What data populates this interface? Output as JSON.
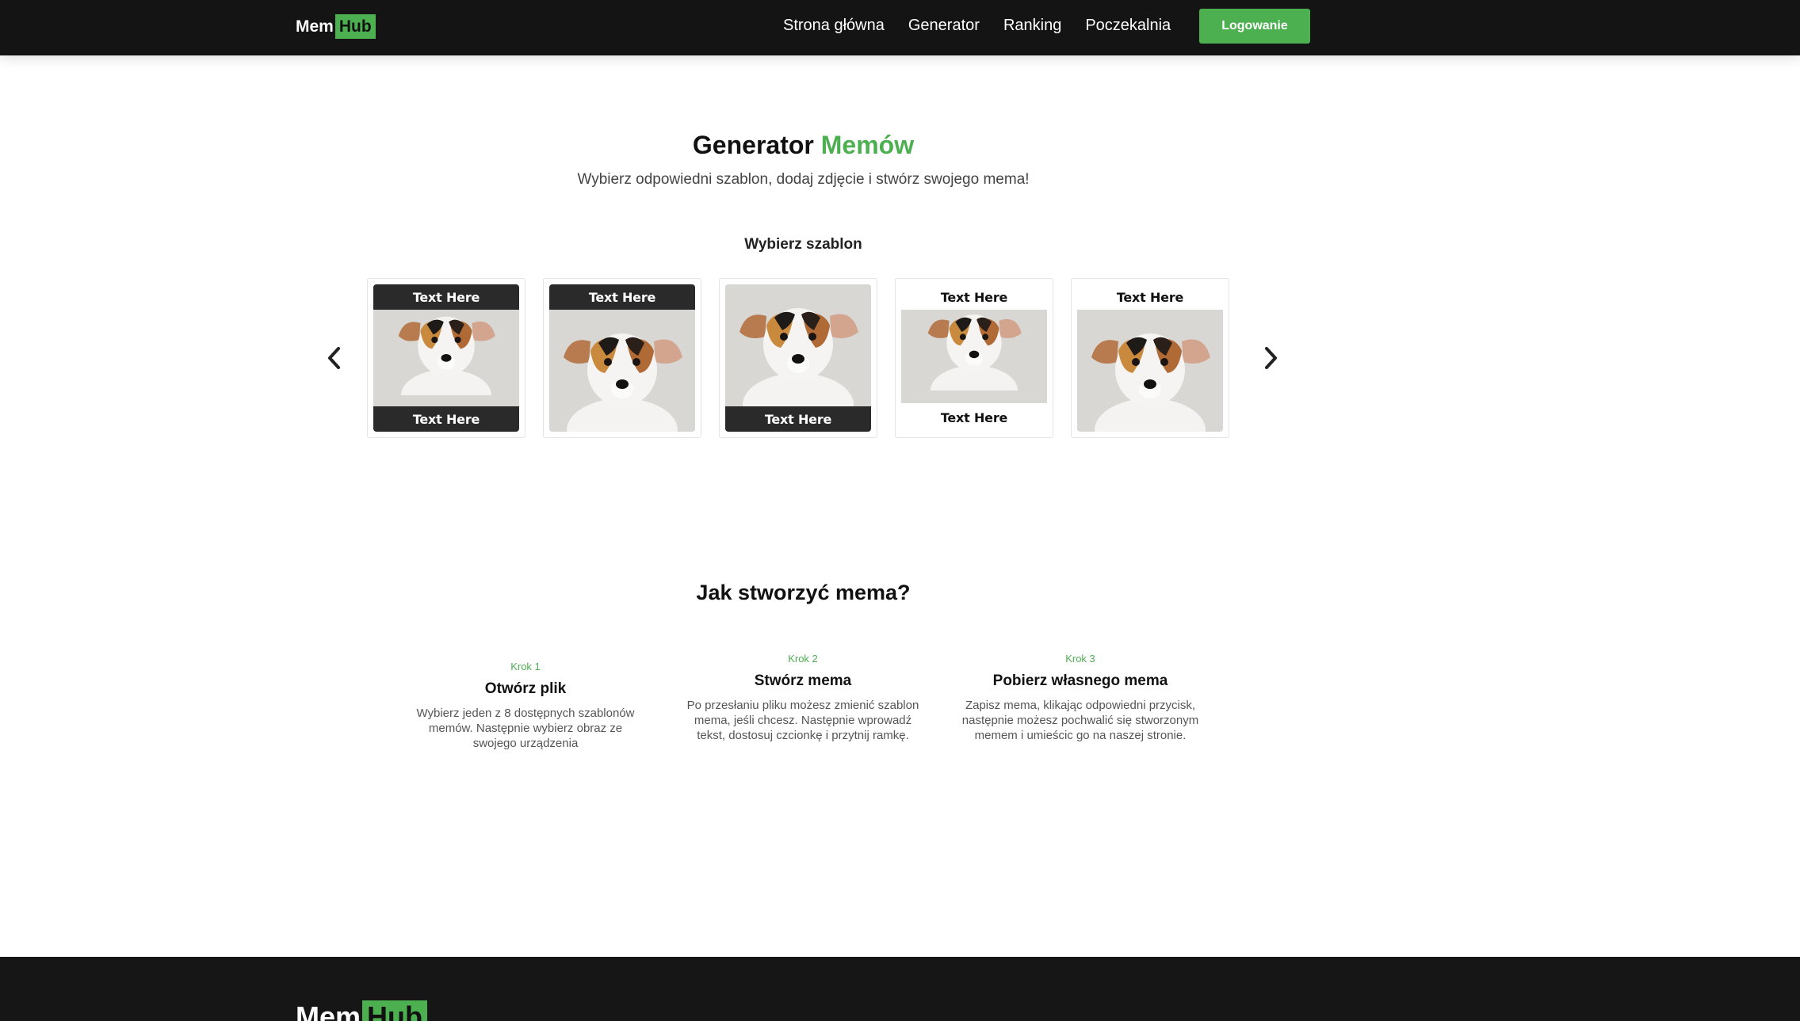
{
  "brand": {
    "part1": "Mem",
    "part2": "Hub",
    "accent": "#4caf50"
  },
  "nav": {
    "links": [
      "Strona główna",
      "Generator",
      "Ranking",
      "Poczekalnia"
    ],
    "login": "Logowanie"
  },
  "hero": {
    "title_part1": "Generator",
    "title_part2": "Memów",
    "subtitle": "Wybierz odpowiedni szablon, dodaj zdjęcie i stwórz swojego mema!"
  },
  "templates": {
    "heading": "Wybierz szablon",
    "caption": "Text Here"
  },
  "how": {
    "title": "Jak stworzyć mema?",
    "steps": [
      {
        "krok": "Krok 1",
        "title": "Otwórz plik",
        "desc": "Wybierz jeden z 8 dostępnych szablonów memów. Następnie wybierz obraz ze swojego urządzenia"
      },
      {
        "krok": "Krok 2",
        "title": "Stwórz mema",
        "desc": "Po przesłaniu pliku możesz zmienić szablon mema, jeśli chcesz. Następnie wprowadź tekst, dostosuj czcionkę i przytnij ramkę."
      },
      {
        "krok": "Krok 3",
        "title": "Pobierz własnego mema",
        "desc": "Zapisz mema, klikając odpowiedni przycisk, następnie możesz pochwalić się stworzonym memem i umieścic go na naszej stronie."
      }
    ]
  },
  "footer": {
    "part1": "Mem",
    "part2": "Hub"
  }
}
